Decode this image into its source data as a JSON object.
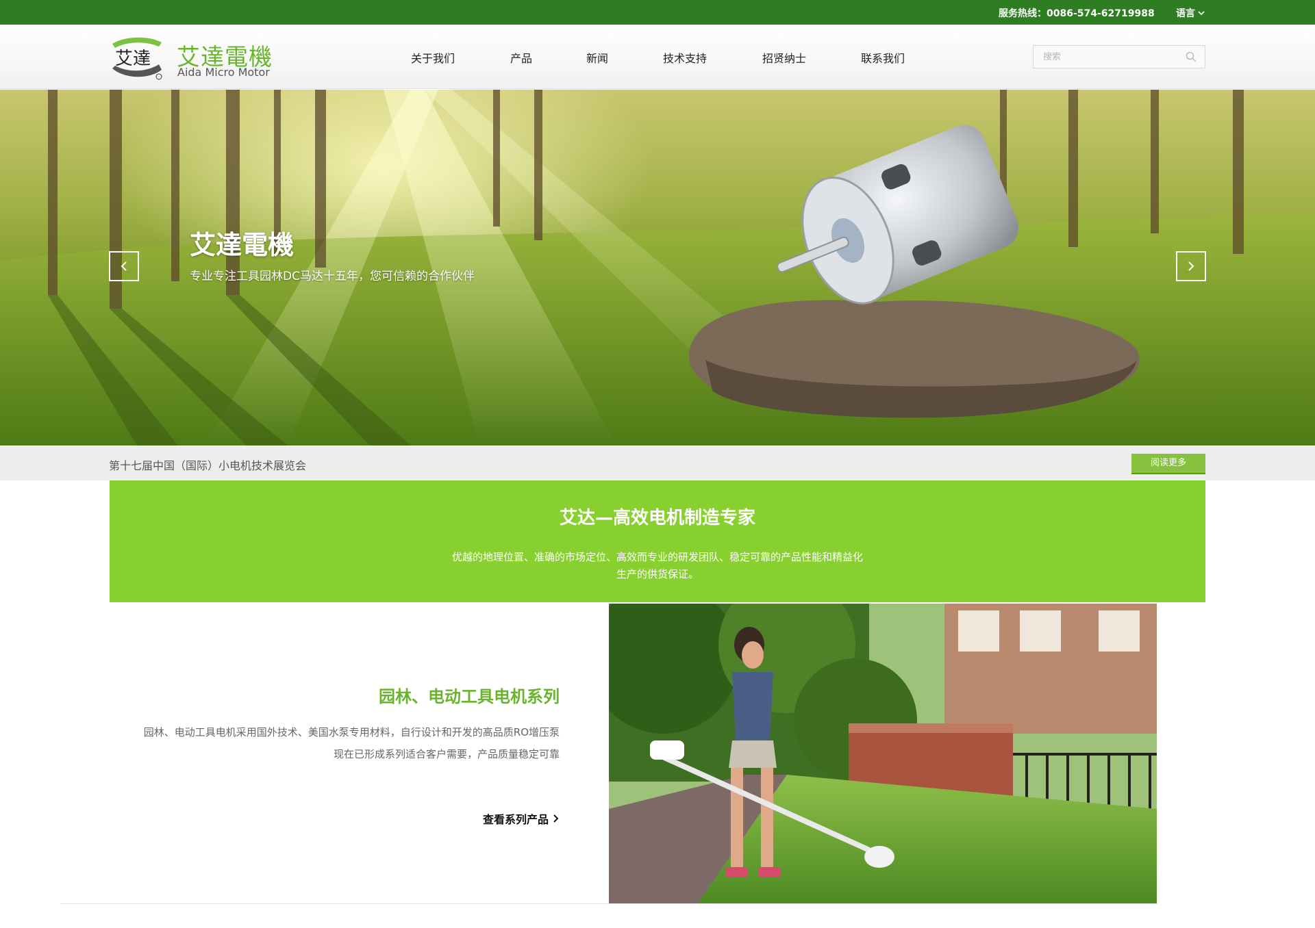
{
  "topbar": {
    "hotline": "服务热线：0086-574-62719988",
    "language_label": "语言"
  },
  "logo": {
    "mark_text": "艾達",
    "brand_cn": "艾達電機",
    "brand_en": "Aida Micro Motor"
  },
  "nav": {
    "items": [
      "关于我们",
      "产品",
      "新闻",
      "技术支持",
      "招贤纳士",
      "联系我们"
    ]
  },
  "search": {
    "placeholder": "搜索"
  },
  "banner": {
    "title": "艾達電機",
    "subtitle": "专业专注工具园林DC马达十五年，您可信赖的合作伙伴"
  },
  "news": {
    "headline": "第十七届中国（国际）小电机技术展览会",
    "more_label": "阅读更多"
  },
  "intro": {
    "title": "艾达—高效电机制造专家",
    "text": "优越的地理位置、准确的市场定位、高效而专业的研发团队、稳定可靠的产品性能和精益化生产的供货保证。"
  },
  "feature": {
    "title": "园林、电动工具电机系列",
    "line1": "园林、电动工具电机采用国外技术、美国水泵专用材料，自行设计和开发的高品质RO增压泵",
    "line2": "现在已形成系列适合客户需要，产品质量稳定可靠",
    "link_label": "查看系列产品"
  },
  "colors": {
    "topbar": "#2f7d22",
    "brand_green": "#6ab42d",
    "intro_bg": "#88d02f",
    "button": "#86c23e"
  }
}
